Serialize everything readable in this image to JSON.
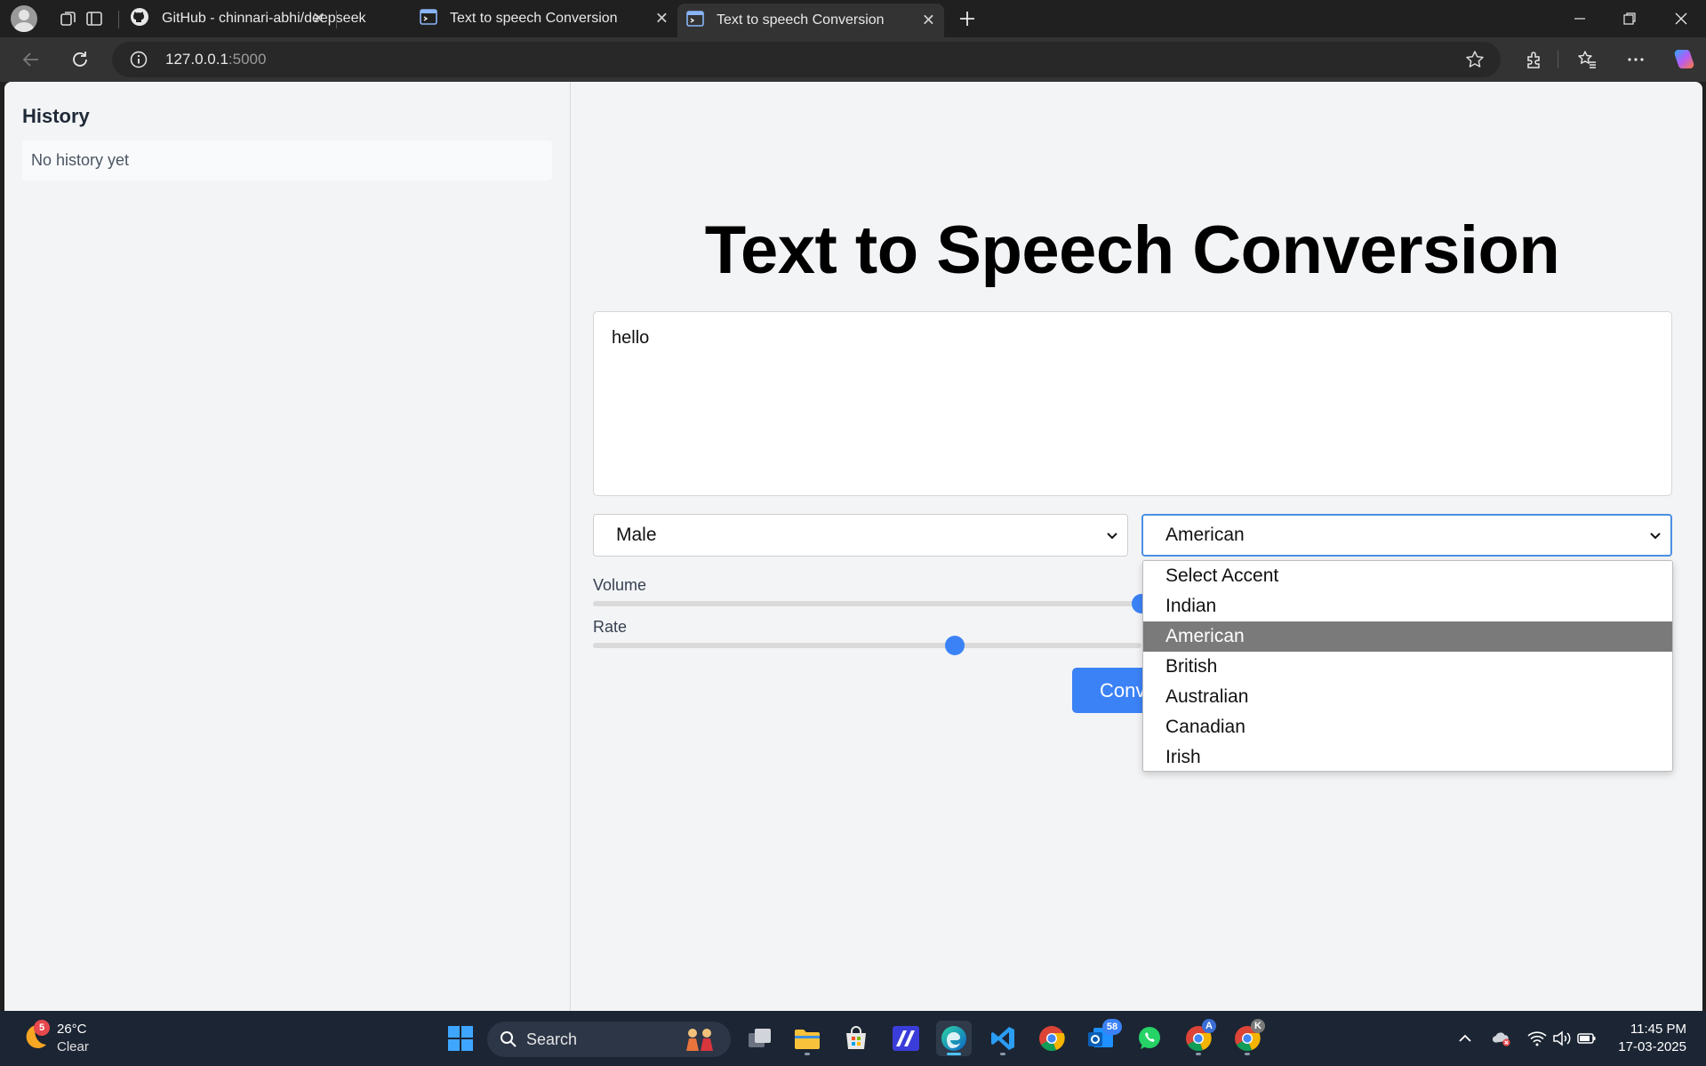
{
  "browser": {
    "tabs": [
      {
        "title": "GitHub - chinnari-abhi/deepseek",
        "icon": "github-icon"
      },
      {
        "title": "Text to speech Conversion",
        "icon": "terminal-icon"
      },
      {
        "title": "Text to speech Conversion",
        "icon": "terminal-icon",
        "active": true
      }
    ],
    "url_host": "127.0.0.1",
    "url_port": ":5000"
  },
  "sidebar": {
    "title": "History",
    "empty_text": "No history yet"
  },
  "main": {
    "title": "Text to Speech Conversion",
    "text_input_value": "hello",
    "gender_select": {
      "value": "Male"
    },
    "accent_select": {
      "value": "American",
      "options": [
        "Select Accent",
        "Indian",
        "American",
        "British",
        "Australian",
        "Canadian",
        "Irish"
      ],
      "selected_index": 2,
      "open": true
    },
    "volume": {
      "label": "Volume",
      "value": 1.0
    },
    "rate": {
      "label": "Rate",
      "value": 0.66
    },
    "convert_button_label": "Conv",
    "accent_color": "#3b82f6"
  },
  "taskbar": {
    "weather": {
      "temp": "26°C",
      "condition": "Clear",
      "badge": "5"
    },
    "search_label": "Search",
    "mail_badge": "58",
    "chrome_badge_a": "A",
    "chrome_badge_k": "K",
    "time": "11:45 PM",
    "date": "17-03-2025"
  }
}
